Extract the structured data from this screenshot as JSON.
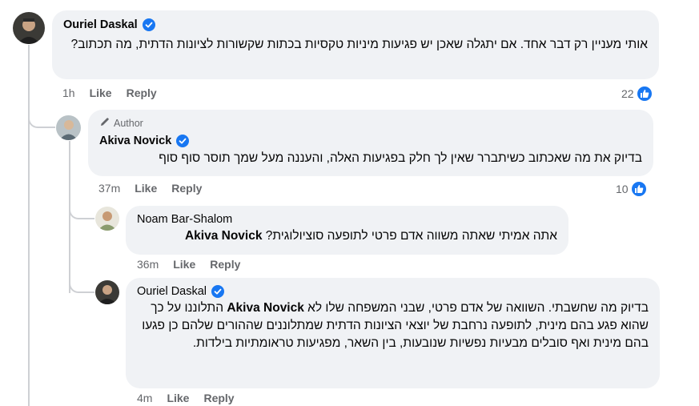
{
  "comments": [
    {
      "author": "Ouriel Daskal",
      "text": "אותי מעניין רק דבר אחד. אם יתגלה שאכן יש פגיעות מיניות טקסיות בכתות שקשורות לציונות הדתית, מה תכתוב?",
      "time": "1h",
      "like_label": "Like",
      "reply_label": "Reply",
      "reaction_count": "22"
    },
    {
      "badge": "Author",
      "author": "Akiva Novick",
      "text": "בדיוק את מה שאכתוב כשיתברר שאין לך חלק בפגיעות האלה, והעננה מעל שמך תוסר סוף סוף",
      "time": "37m",
      "like_label": "Like",
      "reply_label": "Reply",
      "reaction_count": "10"
    },
    {
      "author": "Noam Bar-Shalom",
      "mention": "Akiva Novick",
      "text": "אתה אמיתי שאתה משווה אדם פרטי לתופעה סוציולוגית?",
      "time": "36m",
      "like_label": "Like",
      "reply_label": "Reply"
    },
    {
      "author": "Ouriel Daskal",
      "mention": "Akiva Novick",
      "text_line1": "בדיוק מה שחשבתי. השוואה של אדם פרטי, שבני המשפחה שלו לא",
      "text_rest": "התלוננו על כך שהוא פגע בהם מינית, לתופעה נרחבת של יוצאי הציונות הדתית שמתלוננים שההורים שלהם כן פגעו בהם מינית ואף סובלים מבעיות נפשיות שנובעות, בין השאר, מפגיעות טראומתיות בילדות.",
      "time": "4m",
      "like_label": "Like",
      "reply_label": "Reply"
    }
  ],
  "colors": {
    "bubble": "#f0f2f5",
    "meta_text": "#65676b",
    "like_blue": "#1877f2",
    "thread_line": "#ced0d4"
  },
  "icons": [
    "verified-badge-icon",
    "pencil-icon",
    "thumbs-up-icon"
  ]
}
